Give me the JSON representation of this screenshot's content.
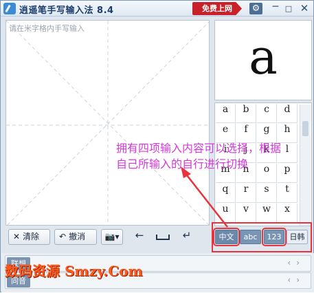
{
  "window": {
    "title": "逍遥笔手写输入法 8.4",
    "free_net_label": "免费上网",
    "minimize_glyph": "─",
    "maximize_glyph": "□",
    "close_glyph": "✕"
  },
  "canvas": {
    "placeholder": "请在米字格内手写输入"
  },
  "toolbar": {
    "clear_label": "清除",
    "undo_label": "撤消"
  },
  "preview": {
    "char": "a"
  },
  "keyboard": {
    "keys": [
      "a",
      "b",
      "c",
      "d",
      "e",
      "f",
      "g",
      "h",
      "i",
      "j",
      "k",
      "l",
      "m",
      "n",
      "o",
      "p",
      "q",
      "r",
      "s",
      "t",
      "u",
      "v",
      "w",
      "x"
    ]
  },
  "modes": {
    "chinese": "中文",
    "abc": "abc",
    "digits": "123",
    "japanese_korean": "日韩"
  },
  "bottom": {
    "row1_label": "联想",
    "row2_label": "同音"
  },
  "annotation": {
    "line1": "拥有四项输入内容可以选择，根据",
    "line2": "自己所输入的自行进行切换"
  },
  "watermark": "数码资源 Smzy.Com",
  "colors": {
    "accent": "#c9212a",
    "highlight": "#e8323c",
    "annotation": "#d43ad8"
  }
}
